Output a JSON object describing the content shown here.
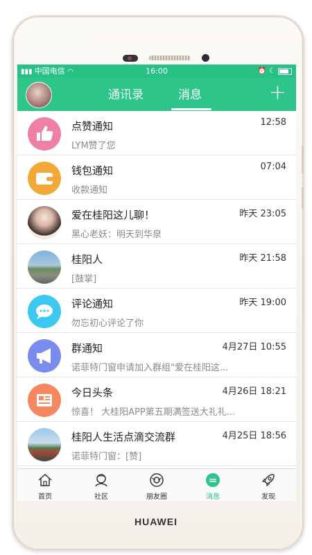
{
  "device": {
    "brand": "HUAWEI"
  },
  "statusbar": {
    "left": "中国电信",
    "time": "16:00",
    "icons": [
      "signal-icon",
      "wifi-icon",
      "alarm-icon",
      "moon-icon",
      "battery-icon"
    ]
  },
  "header": {
    "tabs": [
      {
        "label": "通讯录",
        "active": false
      },
      {
        "label": "消息",
        "active": true
      }
    ],
    "add_label": "+"
  },
  "messages": [
    {
      "icon": "thumbs-up-icon",
      "title": "点赞通知",
      "subtitle": "LYM赞了您",
      "time": "12:58"
    },
    {
      "icon": "wallet-icon",
      "title": "钱包通知",
      "subtitle": "收款通知",
      "time": "07:04"
    },
    {
      "icon": "avatar-photo",
      "title": "爱在桂阳这儿聊！",
      "subtitle": "黑心老妖：明天到华泉",
      "time": "昨天 23:05"
    },
    {
      "icon": "city-photo",
      "title": "桂阳人",
      "subtitle": "[鼓掌]",
      "time": "昨天 21:58"
    },
    {
      "icon": "comment-icon",
      "title": "评论通知",
      "subtitle": "勿忘初心评论了你",
      "time": "昨天 19:00"
    },
    {
      "icon": "megaphone-icon",
      "title": "群通知",
      "subtitle": "诺菲特门窗申请加入群组\"爱在桂阳这...",
      "time": "4月27日 10:55"
    },
    {
      "icon": "newspaper-icon",
      "title": "今日头条",
      "subtitle": "惊喜！ 大桂阳APP第五期满签送大礼礼...",
      "time": "4月26日 18:21"
    },
    {
      "icon": "landscape-photo",
      "title": "桂阳人生活点滴交流群",
      "subtitle": "诺菲特门窗：[赞]",
      "time": "4月25日 18:56"
    }
  ],
  "tabbar": [
    {
      "icon": "home-icon",
      "label": "首页"
    },
    {
      "icon": "community-icon",
      "label": "社区"
    },
    {
      "icon": "moments-icon",
      "label": "朋友圈"
    },
    {
      "icon": "message-icon",
      "label": "消息",
      "active": true
    },
    {
      "icon": "rocket-icon",
      "label": "发现"
    }
  ],
  "colors": {
    "accent": "#2ec58a",
    "status_bar": "#27c185"
  }
}
